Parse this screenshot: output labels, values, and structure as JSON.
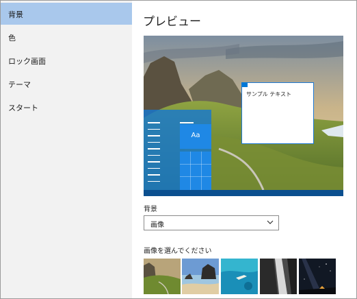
{
  "sidebar": {
    "items": [
      {
        "label": "背景",
        "active": true
      },
      {
        "label": "色",
        "active": false
      },
      {
        "label": "ロック画面",
        "active": false
      },
      {
        "label": "テーマ",
        "active": false
      },
      {
        "label": "スタート",
        "active": false
      }
    ]
  },
  "main": {
    "title": "プレビュー",
    "preview": {
      "sample_text": "サンプル テキスト",
      "tile_label": "Aa"
    },
    "background_label": "背景",
    "background_select": {
      "value": "画像"
    },
    "choose_picture_label": "画像を選んでください",
    "thumbnails": [
      {
        "name": "mountain-cliffs"
      },
      {
        "name": "beach-rocks"
      },
      {
        "name": "underwater-swimmer"
      },
      {
        "name": "waterfall-bw"
      },
      {
        "name": "night-sky-tent"
      }
    ]
  },
  "colors": {
    "accent": "#0078d7",
    "sidebar_bg": "#f2f2f2",
    "sidebar_active": "#a9c8ec"
  }
}
